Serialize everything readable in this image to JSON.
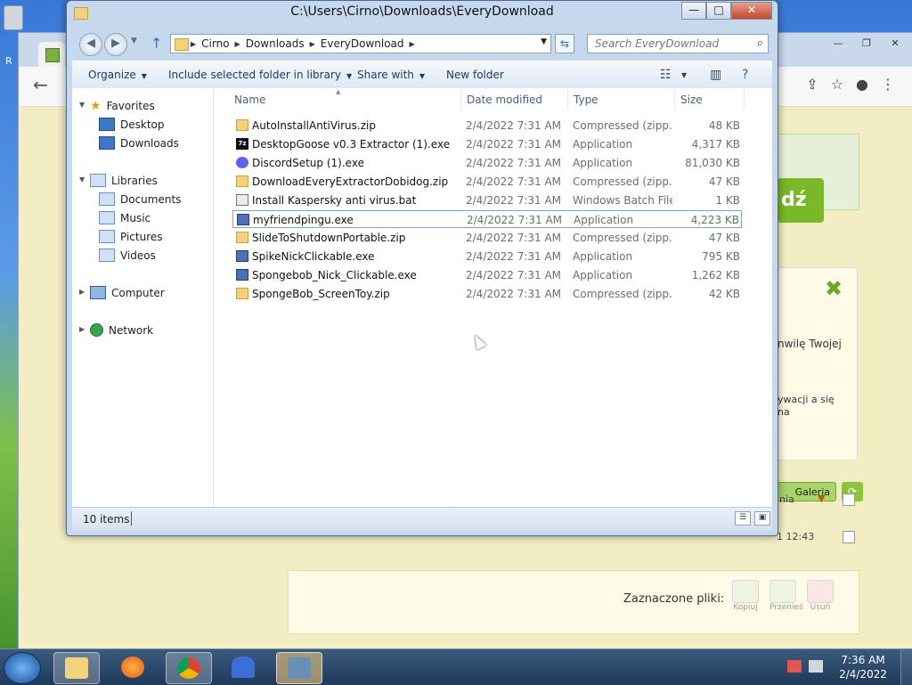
{
  "background_browser": {
    "promo_button_text": "dź",
    "side_text_1": "nwilę Twojej",
    "side_text_2": "ywacji a się na",
    "gallery_button": "Galeria",
    "row1_text": "inia",
    "row2_text": "1 12:43",
    "selected_files_label": "Zaznaczone pliki:",
    "actions": [
      "Kopiuj",
      "Przenieś",
      "Usuń"
    ]
  },
  "explorer": {
    "title": "C:\\Users\\Cirno\\Downloads\\EveryDownload",
    "breadcrumbs": [
      "Cirno",
      "Downloads",
      "EveryDownload"
    ],
    "search_placeholder": "Search EveryDownload",
    "toolbar": {
      "organize": "Organize",
      "include_library": "Include selected folder in library",
      "share_with": "Share with",
      "new_folder": "New folder"
    },
    "nav": {
      "favorites": "Favorites",
      "desktop": "Desktop",
      "downloads": "Downloads",
      "libraries": "Libraries",
      "documents": "Documents",
      "music": "Music",
      "pictures": "Pictures",
      "videos": "Videos",
      "computer": "Computer",
      "network": "Network"
    },
    "columns": {
      "name": "Name",
      "date": "Date modified",
      "type": "Type",
      "size": "Size"
    },
    "files": [
      {
        "name": "AutoInstallAntiVirus.zip",
        "date": "2/4/2022 7:31 AM",
        "type": "Compressed (zipp...",
        "size": "48 KB",
        "icon": "zip-folder-icon"
      },
      {
        "name": "DesktopGoose v0.3 Extractor (1).exe",
        "date": "2/4/2022 7:31 AM",
        "type": "Application",
        "size": "4,317 KB",
        "icon": "7zip-icon"
      },
      {
        "name": "DiscordSetup (1).exe",
        "date": "2/4/2022 7:31 AM",
        "type": "Application",
        "size": "81,030 KB",
        "icon": "discord-icon"
      },
      {
        "name": "DownloadEveryExtractorDobidog.zip",
        "date": "2/4/2022 7:31 AM",
        "type": "Compressed (zipp...",
        "size": "47 KB",
        "icon": "zip-folder-icon"
      },
      {
        "name": "Install Kaspersky anti virus.bat",
        "date": "2/4/2022 7:31 AM",
        "type": "Windows Batch File",
        "size": "1 KB",
        "icon": "batch-file-icon"
      },
      {
        "name": "myfriendpingu.exe",
        "date": "2/4/2022 7:31 AM",
        "type": "Application",
        "size": "4,223 KB",
        "icon": "exe-icon",
        "selected": true
      },
      {
        "name": "SlideToShutdownPortable.zip",
        "date": "2/4/2022 7:31 AM",
        "type": "Compressed (zipp...",
        "size": "47 KB",
        "icon": "zip-folder-icon"
      },
      {
        "name": "SpikeNickClickable.exe",
        "date": "2/4/2022 7:31 AM",
        "type": "Application",
        "size": "795 KB",
        "icon": "exe-icon"
      },
      {
        "name": "Spongebob_Nick_Clickable.exe",
        "date": "2/4/2022 7:31 AM",
        "type": "Application",
        "size": "1,262 KB",
        "icon": "exe-icon"
      },
      {
        "name": "SpongeBob_ScreenToy.zip",
        "date": "2/4/2022 7:31 AM",
        "type": "Compressed (zipp...",
        "size": "42 KB",
        "icon": "zip-folder-icon"
      }
    ],
    "status": "10 items"
  },
  "taskbar": {
    "time": "7:36 AM",
    "date": "2/4/2022"
  }
}
